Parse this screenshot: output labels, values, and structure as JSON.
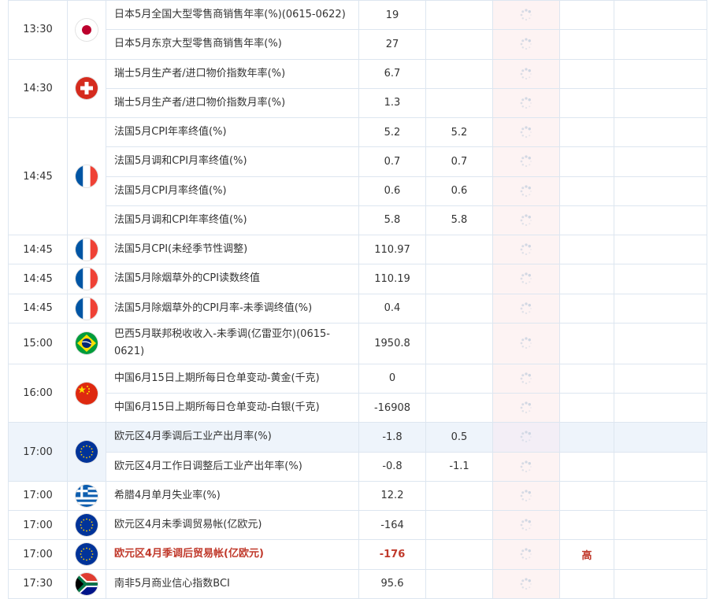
{
  "colors": {
    "accent_red": "#c0392b",
    "row_highlight": "#eef4fb",
    "actual_bg": "#fdf3f3",
    "border": "#dde6f0"
  },
  "groups": [
    {
      "time": "13:30",
      "flag": "japan-flag",
      "rows": [
        {
          "name": "日本5月全国大型零售商销售年率(%)(0615-0622)",
          "prev": "19",
          "forecast": ""
        },
        {
          "name": "日本5月东京大型零售商销售年率(%)",
          "prev": "27",
          "forecast": ""
        }
      ]
    },
    {
      "time": "14:30",
      "flag": "switzerland-flag",
      "rows": [
        {
          "name": "瑞士5月生产者/进口物价指数年率(%)",
          "prev": "6.7",
          "forecast": ""
        },
        {
          "name": "瑞士5月生产者/进口物价指数月率(%)",
          "prev": "1.3",
          "forecast": ""
        }
      ]
    },
    {
      "time": "14:45",
      "flag": "france-flag",
      "rows": [
        {
          "name": "法国5月CPI年率终值(%)",
          "prev": "5.2",
          "forecast": "5.2"
        },
        {
          "name": "法国5月调和CPI月率终值(%)",
          "prev": "0.7",
          "forecast": "0.7"
        },
        {
          "name": "法国5月CPI月率终值(%)",
          "prev": "0.6",
          "forecast": "0.6"
        },
        {
          "name": "法国5月调和CPI年率终值(%)",
          "prev": "5.8",
          "forecast": "5.8"
        }
      ]
    },
    {
      "time": "14:45",
      "flag": "france-flag",
      "rows": [
        {
          "name": "法国5月CPI(未经季节性调整)",
          "prev": "110.97",
          "forecast": ""
        }
      ]
    },
    {
      "time": "14:45",
      "flag": "france-flag",
      "rows": [
        {
          "name": "法国5月除烟草外的CPI读数终值",
          "prev": "110.19",
          "forecast": ""
        }
      ]
    },
    {
      "time": "14:45",
      "flag": "france-flag",
      "rows": [
        {
          "name": "法国5月除烟草外的CPI月率-未季调终值(%)",
          "prev": "0.4",
          "forecast": ""
        }
      ]
    },
    {
      "time": "15:00",
      "flag": "brazil-flag",
      "rows": [
        {
          "name": "巴西5月联邦税收收入-未季调(亿雷亚尔)(0615-0621)",
          "prev": "1950.8",
          "forecast": "",
          "tall": true
        }
      ]
    },
    {
      "time": "16:00",
      "flag": "china-flag",
      "rows": [
        {
          "name": "中国6月15日上期所每日仓单变动-黄金(千克)",
          "prev": "0",
          "forecast": ""
        },
        {
          "name": "中国6月15日上期所每日仓单变动-白银(千克)",
          "prev": "-16908",
          "forecast": ""
        }
      ]
    },
    {
      "time": "17:00",
      "flag": "eu-flag",
      "rows": [
        {
          "name": "欧元区4月季调后工业产出月率(%)",
          "prev": "-1.8",
          "forecast": "0.5",
          "highlight": true
        },
        {
          "name": "欧元区4月工作日调整后工业产出年率(%)",
          "prev": "-0.8",
          "forecast": "-1.1"
        }
      ]
    },
    {
      "time": "17:00",
      "flag": "greece-flag",
      "rows": [
        {
          "name": "希腊4月单月失业率(%)",
          "prev": "12.2",
          "forecast": ""
        }
      ]
    },
    {
      "time": "17:00",
      "flag": "eu-flag",
      "rows": [
        {
          "name": "欧元区4月未季调贸易帐(亿欧元)",
          "prev": "-164",
          "forecast": ""
        }
      ]
    },
    {
      "time": "17:00",
      "flag": "eu-flag",
      "rows": [
        {
          "name": "欧元区4月季调后贸易帐(亿欧元)",
          "prev": "-176",
          "forecast": "",
          "importance": "高",
          "red": true
        }
      ]
    },
    {
      "time": "17:30",
      "flag": "south-africa-flag",
      "rows": [
        {
          "name": "南非5月商业信心指数BCI",
          "prev": "95.6",
          "forecast": ""
        }
      ]
    }
  ]
}
